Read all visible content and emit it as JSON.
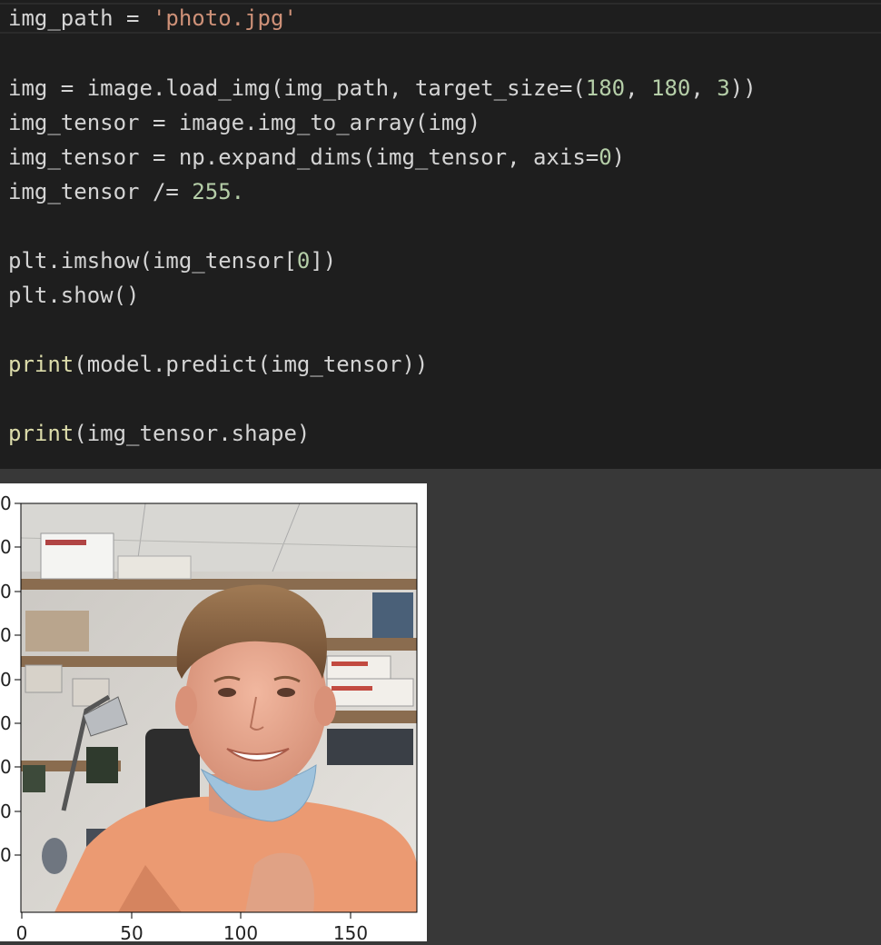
{
  "code_cell": {
    "line1": {
      "a": "img_path = ",
      "b": "'photo.jpg'"
    },
    "line3": {
      "a": "img = image.load_img(img_path, target_size=(",
      "n1": "180",
      "c": ", ",
      "n2": "180",
      "d": ", ",
      "n3": "3",
      "e": "))"
    },
    "line4": "img_tensor = image.img_to_array(img)",
    "line5": {
      "a": "img_tensor = np.expand_dims(img_tensor, axis=",
      "n": "0",
      "b": ")"
    },
    "line6": {
      "a": "img_tensor /= ",
      "n": "255."
    },
    "line8": {
      "a": "plt.imshow(img_tensor[",
      "n": "0",
      "b": "])"
    },
    "line9": "plt.show()",
    "line11": {
      "fn": "print",
      "a": "(model.predict(img_tensor))"
    },
    "line13": {
      "fn": "print",
      "a": "(img_tensor.shape)"
    }
  },
  "plot": {
    "x_tick_labels": [
      "0",
      "50",
      "100",
      "150"
    ],
    "y_tick_labels": [
      "0",
      "0",
      "0",
      "0",
      "0",
      "0",
      "0",
      "0",
      "0"
    ]
  },
  "colors": {
    "editor_bg": "#1e1e1e",
    "output_bg": "#383838",
    "string": "#ce9178",
    "number": "#b5cea8",
    "function": "#dcdcaa"
  }
}
